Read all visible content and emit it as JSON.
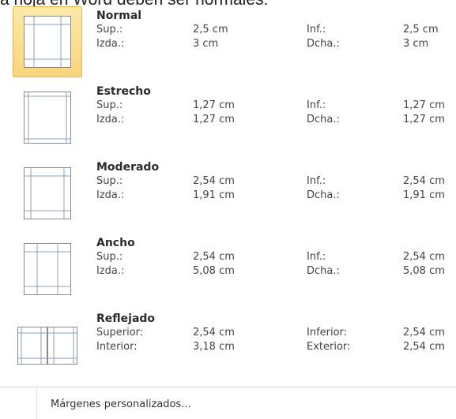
{
  "caption": "a hoja en Word deben ser normales:",
  "presets": [
    {
      "name": "Normal",
      "top_label": "Sup.:",
      "top_value": "2,5 cm",
      "bottom_label": "Inf.:",
      "bottom_value": "2,5 cm",
      "left_label": "Izda.:",
      "left_value": "3 cm",
      "right_label": "Dcha.:",
      "right_value": "3 cm",
      "selected": true
    },
    {
      "name": "Estrecho",
      "top_label": "Sup.:",
      "top_value": "1,27 cm",
      "bottom_label": "Inf.:",
      "bottom_value": "1,27 cm",
      "left_label": "Izda.:",
      "left_value": "1,27 cm",
      "right_label": "Dcha.:",
      "right_value": "1,27 cm",
      "selected": false
    },
    {
      "name": "Moderado",
      "top_label": "Sup.:",
      "top_value": "2,54 cm",
      "bottom_label": "Inf.:",
      "bottom_value": "2,54 cm",
      "left_label": "Izda.:",
      "left_value": "1,91 cm",
      "right_label": "Dcha.:",
      "right_value": "1,91 cm",
      "selected": false
    },
    {
      "name": "Ancho",
      "top_label": "Sup.:",
      "top_value": "2,54 cm",
      "bottom_label": "Inf.:",
      "bottom_value": "2,54 cm",
      "left_label": "Izda.:",
      "left_value": "5,08 cm",
      "right_label": "Dcha.:",
      "right_value": "5,08 cm",
      "selected": false
    },
    {
      "name": "Reflejado",
      "top_label": "Superior:",
      "top_value": "2,54 cm",
      "bottom_label": "Inferior:",
      "bottom_value": "2,54 cm",
      "left_label": "Interior:",
      "left_value": "3,18 cm",
      "right_label": "Exterior:",
      "right_value": "2,54 cm",
      "selected": false
    }
  ],
  "custom_margins_label": "Márgenes personalizados...",
  "colors": {
    "highlight": "#f9d57c",
    "highlight_border": "#e5b648"
  }
}
